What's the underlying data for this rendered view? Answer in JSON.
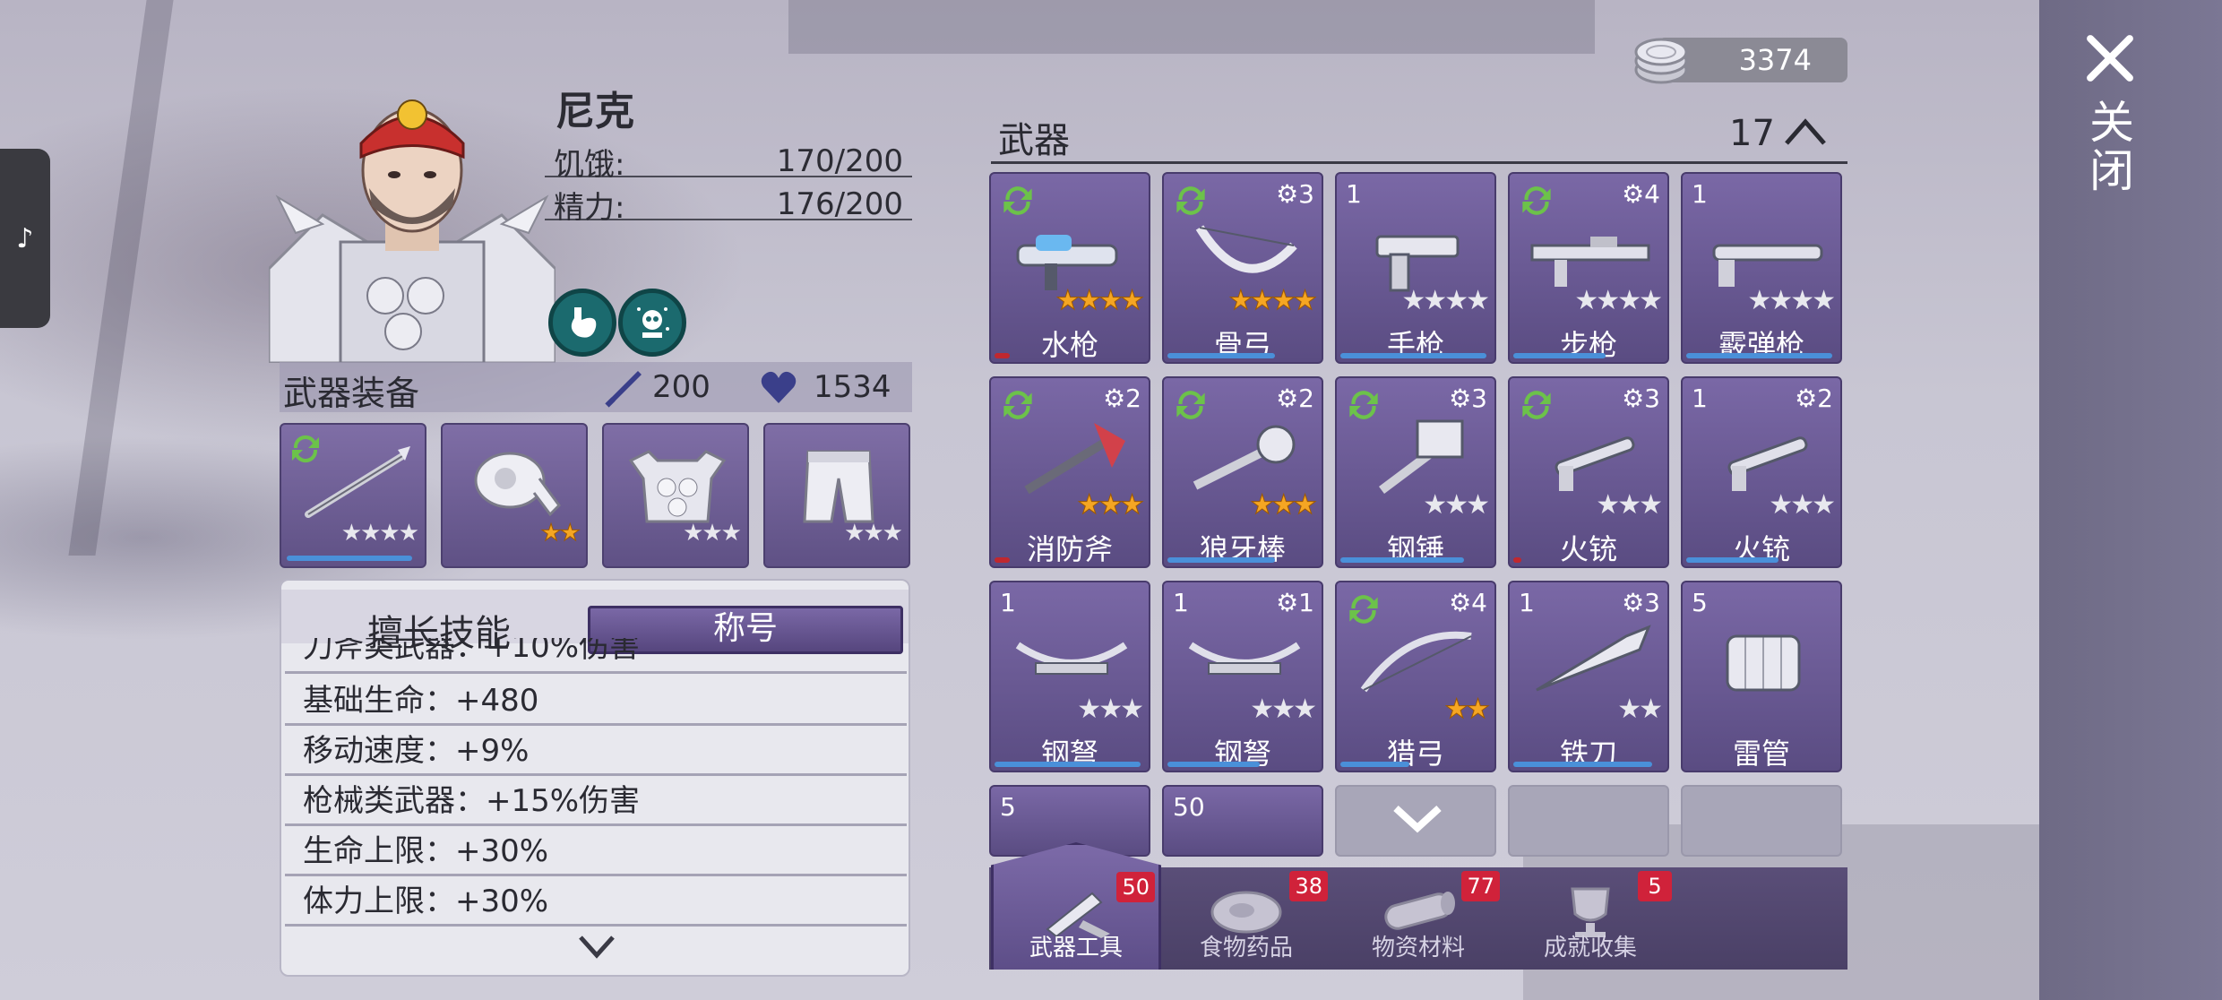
{
  "character": {
    "name": "尼克",
    "hunger_label": "饥饿:",
    "hunger_value": "170/200",
    "energy_label": "精力:",
    "energy_value": "176/200"
  },
  "equipment": {
    "title": "武器装备",
    "attack": "200",
    "health": "1534",
    "slots": [
      {
        "name": "spear",
        "stars_gold": 0,
        "stars_grey": 4,
        "bar_color": "#4a90d9"
      },
      {
        "name": "headband",
        "stars_gold": 2,
        "stars_grey": 0
      },
      {
        "name": "armor",
        "stars_gold": 0,
        "stars_grey": 3
      },
      {
        "name": "pants",
        "stars_gold": 0,
        "stars_grey": 3
      }
    ]
  },
  "skills": {
    "tab_skills": "擅长技能",
    "tab_title": "称号",
    "rows": [
      "刀斧类武器：+10%伤害",
      "基础生命：+480",
      "移动速度：+9%",
      "枪械类武器：+15%伤害",
      "生命上限：+30%",
      "体力上限：+30%"
    ]
  },
  "coins": "3374",
  "weapons": {
    "title": "武器",
    "count": "17",
    "items": [
      {
        "name": "水枪",
        "qty": "",
        "gear": "",
        "refresh": true,
        "gold": 4,
        "grey": 0,
        "bar": "#c0282f",
        "bar_frac": 0.1
      },
      {
        "name": "骨弓",
        "qty": "",
        "gear": "3",
        "refresh": true,
        "gold": 4,
        "grey": 0,
        "bar": "#4a90d9",
        "bar_frac": 0.7
      },
      {
        "name": "手枪",
        "qty": "1",
        "gear": "",
        "refresh": false,
        "gold": 0,
        "grey": 4,
        "bar": "#4a90d9",
        "bar_frac": 0.95
      },
      {
        "name": "步枪",
        "qty": "",
        "gear": "4",
        "refresh": true,
        "gold": 0,
        "grey": 4,
        "bar": "#4a90d9",
        "bar_frac": 0.6
      },
      {
        "name": "霰弹枪",
        "qty": "1",
        "gear": "",
        "refresh": false,
        "gold": 0,
        "grey": 4,
        "bar": "#4a90d9",
        "bar_frac": 0.95
      },
      {
        "name": "消防斧",
        "qty": "",
        "gear": "2",
        "refresh": true,
        "gold": 3,
        "grey": 0,
        "bar": "#c0282f",
        "bar_frac": 0.1
      },
      {
        "name": "狼牙棒",
        "qty": "",
        "gear": "2",
        "refresh": true,
        "gold": 3,
        "grey": 0,
        "bar": "#4a90d9",
        "bar_frac": 0.7
      },
      {
        "name": "钢锤",
        "qty": "",
        "gear": "3",
        "refresh": true,
        "gold": 0,
        "grey": 3,
        "bar": "#4a90d9",
        "bar_frac": 0.8
      },
      {
        "name": "火铳",
        "qty": "",
        "gear": "3",
        "refresh": true,
        "gold": 0,
        "grey": 3,
        "bar": "#c0282f",
        "bar_frac": 0.05
      },
      {
        "name": "火铳",
        "qty": "1",
        "gear": "2",
        "refresh": false,
        "gold": 0,
        "grey": 3,
        "bar": "#4a90d9",
        "bar_frac": 0.6
      },
      {
        "name": "钢弩",
        "qty": "1",
        "gear": "",
        "refresh": false,
        "gold": 0,
        "grey": 3,
        "bar": "#4a90d9",
        "bar_frac": 0.95
      },
      {
        "name": "钢弩",
        "qty": "1",
        "gear": "1",
        "refresh": false,
        "gold": 0,
        "grey": 3,
        "bar": "#4a90d9",
        "bar_frac": 0.6
      },
      {
        "name": "猎弓",
        "qty": "",
        "gear": "4",
        "refresh": true,
        "gold": 2,
        "grey": 0,
        "bar": "#4a90d9",
        "bar_frac": 0.45
      },
      {
        "name": "铁刀",
        "qty": "1",
        "gear": "3",
        "refresh": false,
        "gold": 0,
        "grey": 2,
        "bar": "#4a90d9",
        "bar_frac": 0.9
      },
      {
        "name": "雷管",
        "qty": "5",
        "gear": "",
        "refresh": false,
        "gold": 0,
        "grey": 0,
        "bar": "",
        "bar_frac": 0
      }
    ],
    "partial_row": [
      {
        "qty": "5"
      },
      {
        "qty": "50"
      }
    ]
  },
  "tabs": [
    {
      "label": "武器工具",
      "badge": "50",
      "icon": "tools-icon",
      "active": true
    },
    {
      "label": "食物药品",
      "badge": "38",
      "icon": "meat-icon",
      "active": false
    },
    {
      "label": "物资材料",
      "badge": "77",
      "icon": "log-icon",
      "active": false
    },
    {
      "label": "成就收集",
      "badge": "5",
      "icon": "trophy-icon",
      "active": false
    }
  ],
  "close_label": "关闭",
  "music_icon": "♪",
  "colors": {
    "gold_star": "#f5a623",
    "panel_purple": "#6d5c97",
    "badge_red": "#d0223a",
    "refresh_green": "#6cc24a"
  }
}
